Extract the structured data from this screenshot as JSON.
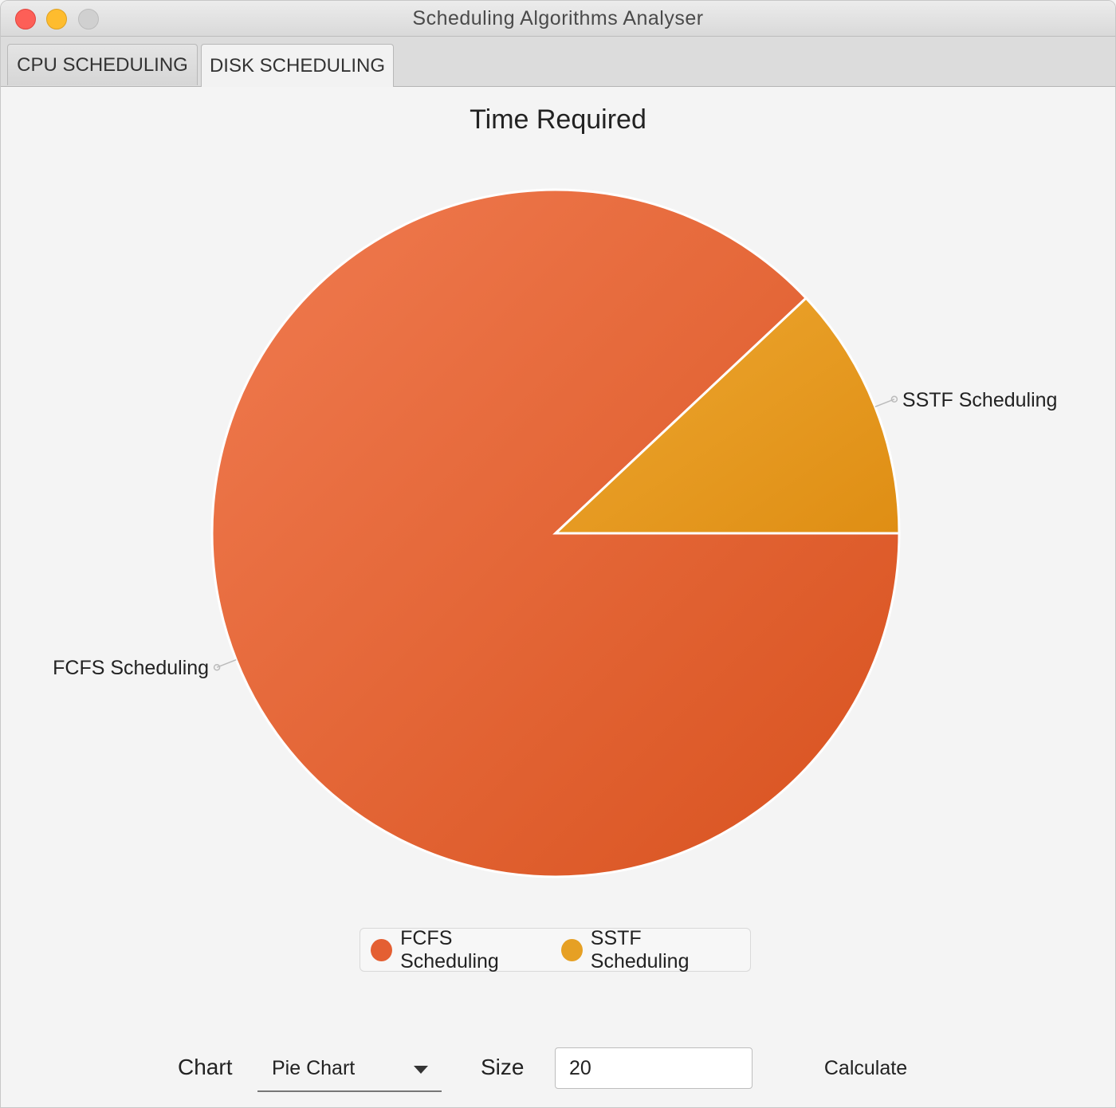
{
  "window": {
    "title": "Scheduling Algorithms Analyser"
  },
  "tabs": [
    {
      "label": "CPU SCHEDULING",
      "selected": false
    },
    {
      "label": "DISK SCHEDULING",
      "selected": true
    }
  ],
  "chart_data": {
    "type": "pie",
    "title": "Time Required",
    "categories": [
      "FCFS Scheduling",
      "SSTF Scheduling"
    ],
    "values": [
      88,
      12
    ],
    "colors": [
      "#e45f32",
      "#e6a024"
    ],
    "legend": "bottom"
  },
  "controls": {
    "chart_label": "Chart",
    "chart_selected": "Pie Chart",
    "size_label": "Size",
    "size_value": "20",
    "calculate_label": "Calculate"
  }
}
